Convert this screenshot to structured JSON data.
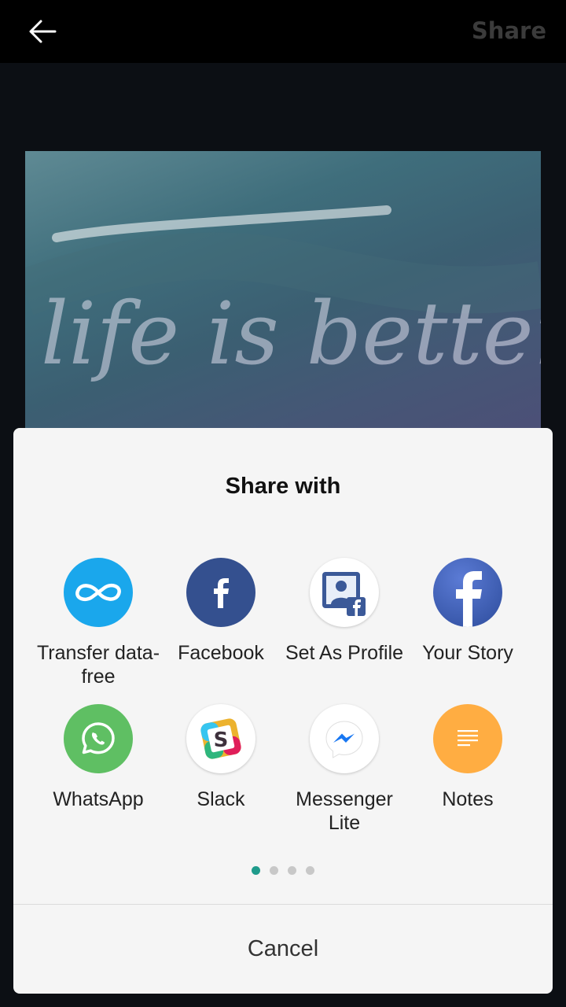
{
  "header": {
    "title": "Share",
    "back_icon": "arrow-left-icon"
  },
  "preview": {
    "text": "life is better at the beach"
  },
  "share_sheet": {
    "title": "Share with",
    "apps": [
      {
        "label": "Transfer data-free",
        "icon": "infinity-icon",
        "color": "#1aa7ec"
      },
      {
        "label": "Facebook",
        "icon": "facebook-icon",
        "color": "#3b5998"
      },
      {
        "label": "Set As Profile",
        "icon": "profile-photo-icon",
        "color": "#3b5998"
      },
      {
        "label": "Your Story",
        "icon": "facebook-icon",
        "color": "#3b5998"
      },
      {
        "label": "WhatsApp",
        "icon": "whatsapp-icon",
        "color": "#5fbf63"
      },
      {
        "label": "Slack",
        "icon": "slack-icon",
        "color": "#ffffff"
      },
      {
        "label": "Messenger Lite",
        "icon": "messenger-icon",
        "color": "#1877f2"
      },
      {
        "label": "Notes",
        "icon": "notes-icon",
        "color": "#ffad42"
      }
    ],
    "page_count": 4,
    "current_page": 1,
    "cancel_label": "Cancel"
  },
  "colors": {
    "accent": "#1f9b8b",
    "sheet_bg": "#f5f5f5"
  }
}
